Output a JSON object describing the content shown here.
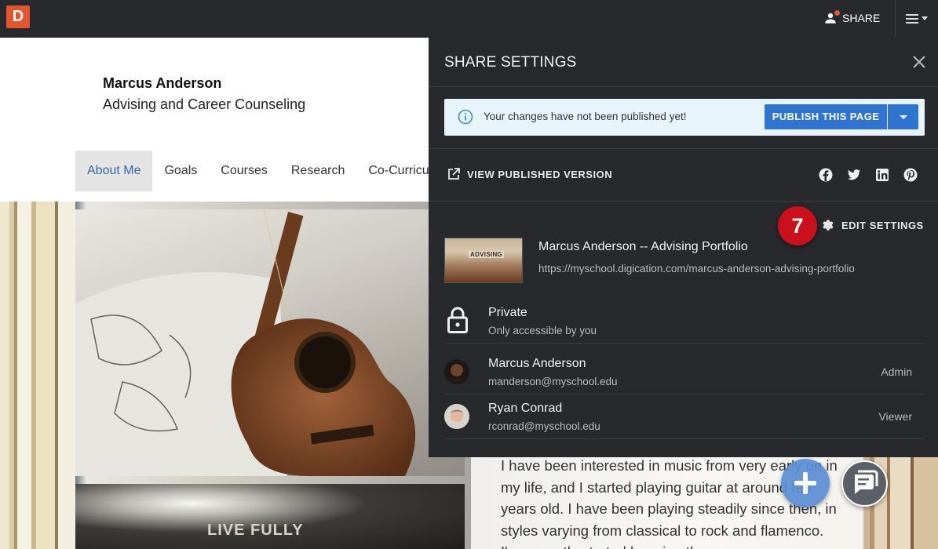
{
  "app": {
    "logo_letter": "D",
    "share_label": "SHARE",
    "menu_icon": "hamburger-menu-icon"
  },
  "page": {
    "owner_name": "Marcus Anderson",
    "owner_department": "Advising and Career Counseling",
    "nav": [
      {
        "label": "About Me",
        "active": true
      },
      {
        "label": "Goals",
        "active": false
      },
      {
        "label": "Courses",
        "active": false
      },
      {
        "label": "Research",
        "active": false
      },
      {
        "label": "Co-Curricu",
        "active": false
      }
    ],
    "quote_text": "LIVE FULLY",
    "bio_text": "I have been interested in music from very early on in my life, and I started playing guitar at around ten years old. I have been playing steadily since then, in styles varying from classical to rock and flamenco. I've recently started learning the"
  },
  "share_panel": {
    "title": "SHARE SETTINGS",
    "notice": {
      "text": "Your changes have not been published yet!",
      "publish_label": "PUBLISH THIS PAGE"
    },
    "view_published_label": "VIEW PUBLISHED VERSION",
    "social_icons": [
      "facebook-icon",
      "twitter-icon",
      "linkedin-icon",
      "pinterest-icon"
    ],
    "step_badge": "7",
    "edit_settings_label": "EDIT SETTINGS",
    "portfolio": {
      "thumbnail_label": "ADVISING",
      "title": "Marcus Anderson -- Advising Portfolio",
      "url": "https://myschool.digication.com/marcus-anderson-advising-portfolio"
    },
    "privacy": {
      "title": "Private",
      "subtitle": "Only accessible by you"
    },
    "members": [
      {
        "name": "Marcus Anderson",
        "email": "manderson@myschool.edu",
        "role": "Admin"
      },
      {
        "name": "Ryan Conrad",
        "email": "rconrad@myschool.edu",
        "role": "Viewer"
      }
    ]
  },
  "colors": {
    "topbar": "#27292c",
    "panel": "#27292c",
    "logo": "#e4572e",
    "primary_button": "#2f74d0",
    "notice_bg": "#e8f4fc",
    "step_badge": "#c9101b",
    "nav_active_text": "#3468a8"
  }
}
